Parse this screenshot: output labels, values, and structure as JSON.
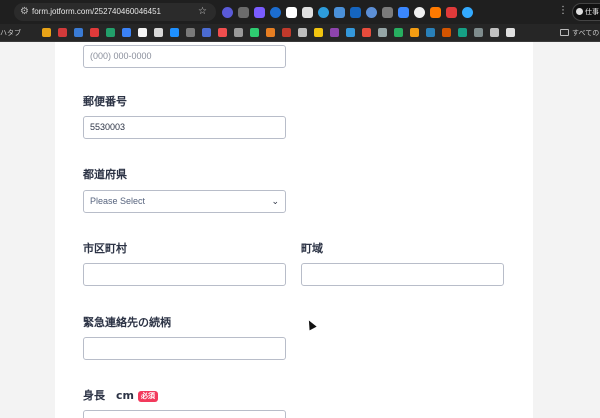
{
  "browser": {
    "url": "form.jotform.com/252740460046451",
    "bookmarks_left": "ハタブ",
    "bookmarks_right": "すべての",
    "profile_label": "仕事",
    "extension_colors": [
      "#5a5ad8",
      "#6b6b6b",
      "#7a5cff",
      "#1c6dd0",
      "#ffffff",
      "#e0e0e0",
      "#2d9cdb",
      "#4a90d9",
      "#1565c0",
      "#5c8fd6",
      "#7b7b7b",
      "#3a87ff",
      "#f0f0f0",
      "#ff7a00",
      "#e03a3a",
      "#33aaff"
    ],
    "bookmark_colors": [
      "#e8a317",
      "#d23a3a",
      "#3a7bd5",
      "#e03a3a",
      "#22a06b",
      "#3b82f6",
      "#f5f5f5",
      "#d9d9d9",
      "#1e90ff",
      "#7a7a7a",
      "#4b6bd1",
      "#f04e4e",
      "#999999",
      "#2ecc71",
      "#e67e22",
      "#c0392b",
      "#bdbdbd",
      "#f1c40f",
      "#8e44ad",
      "#3498db",
      "#e74c3c",
      "#95a5a6",
      "#27ae60",
      "#f39c12",
      "#2980b9",
      "#d35400",
      "#16a085",
      "#7f8c8d",
      "#c0c0c0",
      "#e0e0e0"
    ]
  },
  "form": {
    "phone": {
      "placeholder": "(000) 000-0000"
    },
    "postal": {
      "label": "郵便番号",
      "value": "5530003"
    },
    "prefecture": {
      "label": "都道府県",
      "selected": "Please Select"
    },
    "city": {
      "label": "市区町村",
      "value": ""
    },
    "town": {
      "label": "町域",
      "value": ""
    },
    "relation": {
      "label": "緊急連絡先の続柄",
      "value": ""
    },
    "height": {
      "label": "身長　cm",
      "required_badge": "必須"
    }
  },
  "colors": {
    "required_badge": "#f23a5c",
    "label_text": "#2c3345",
    "field_border": "#b8bdc9"
  }
}
